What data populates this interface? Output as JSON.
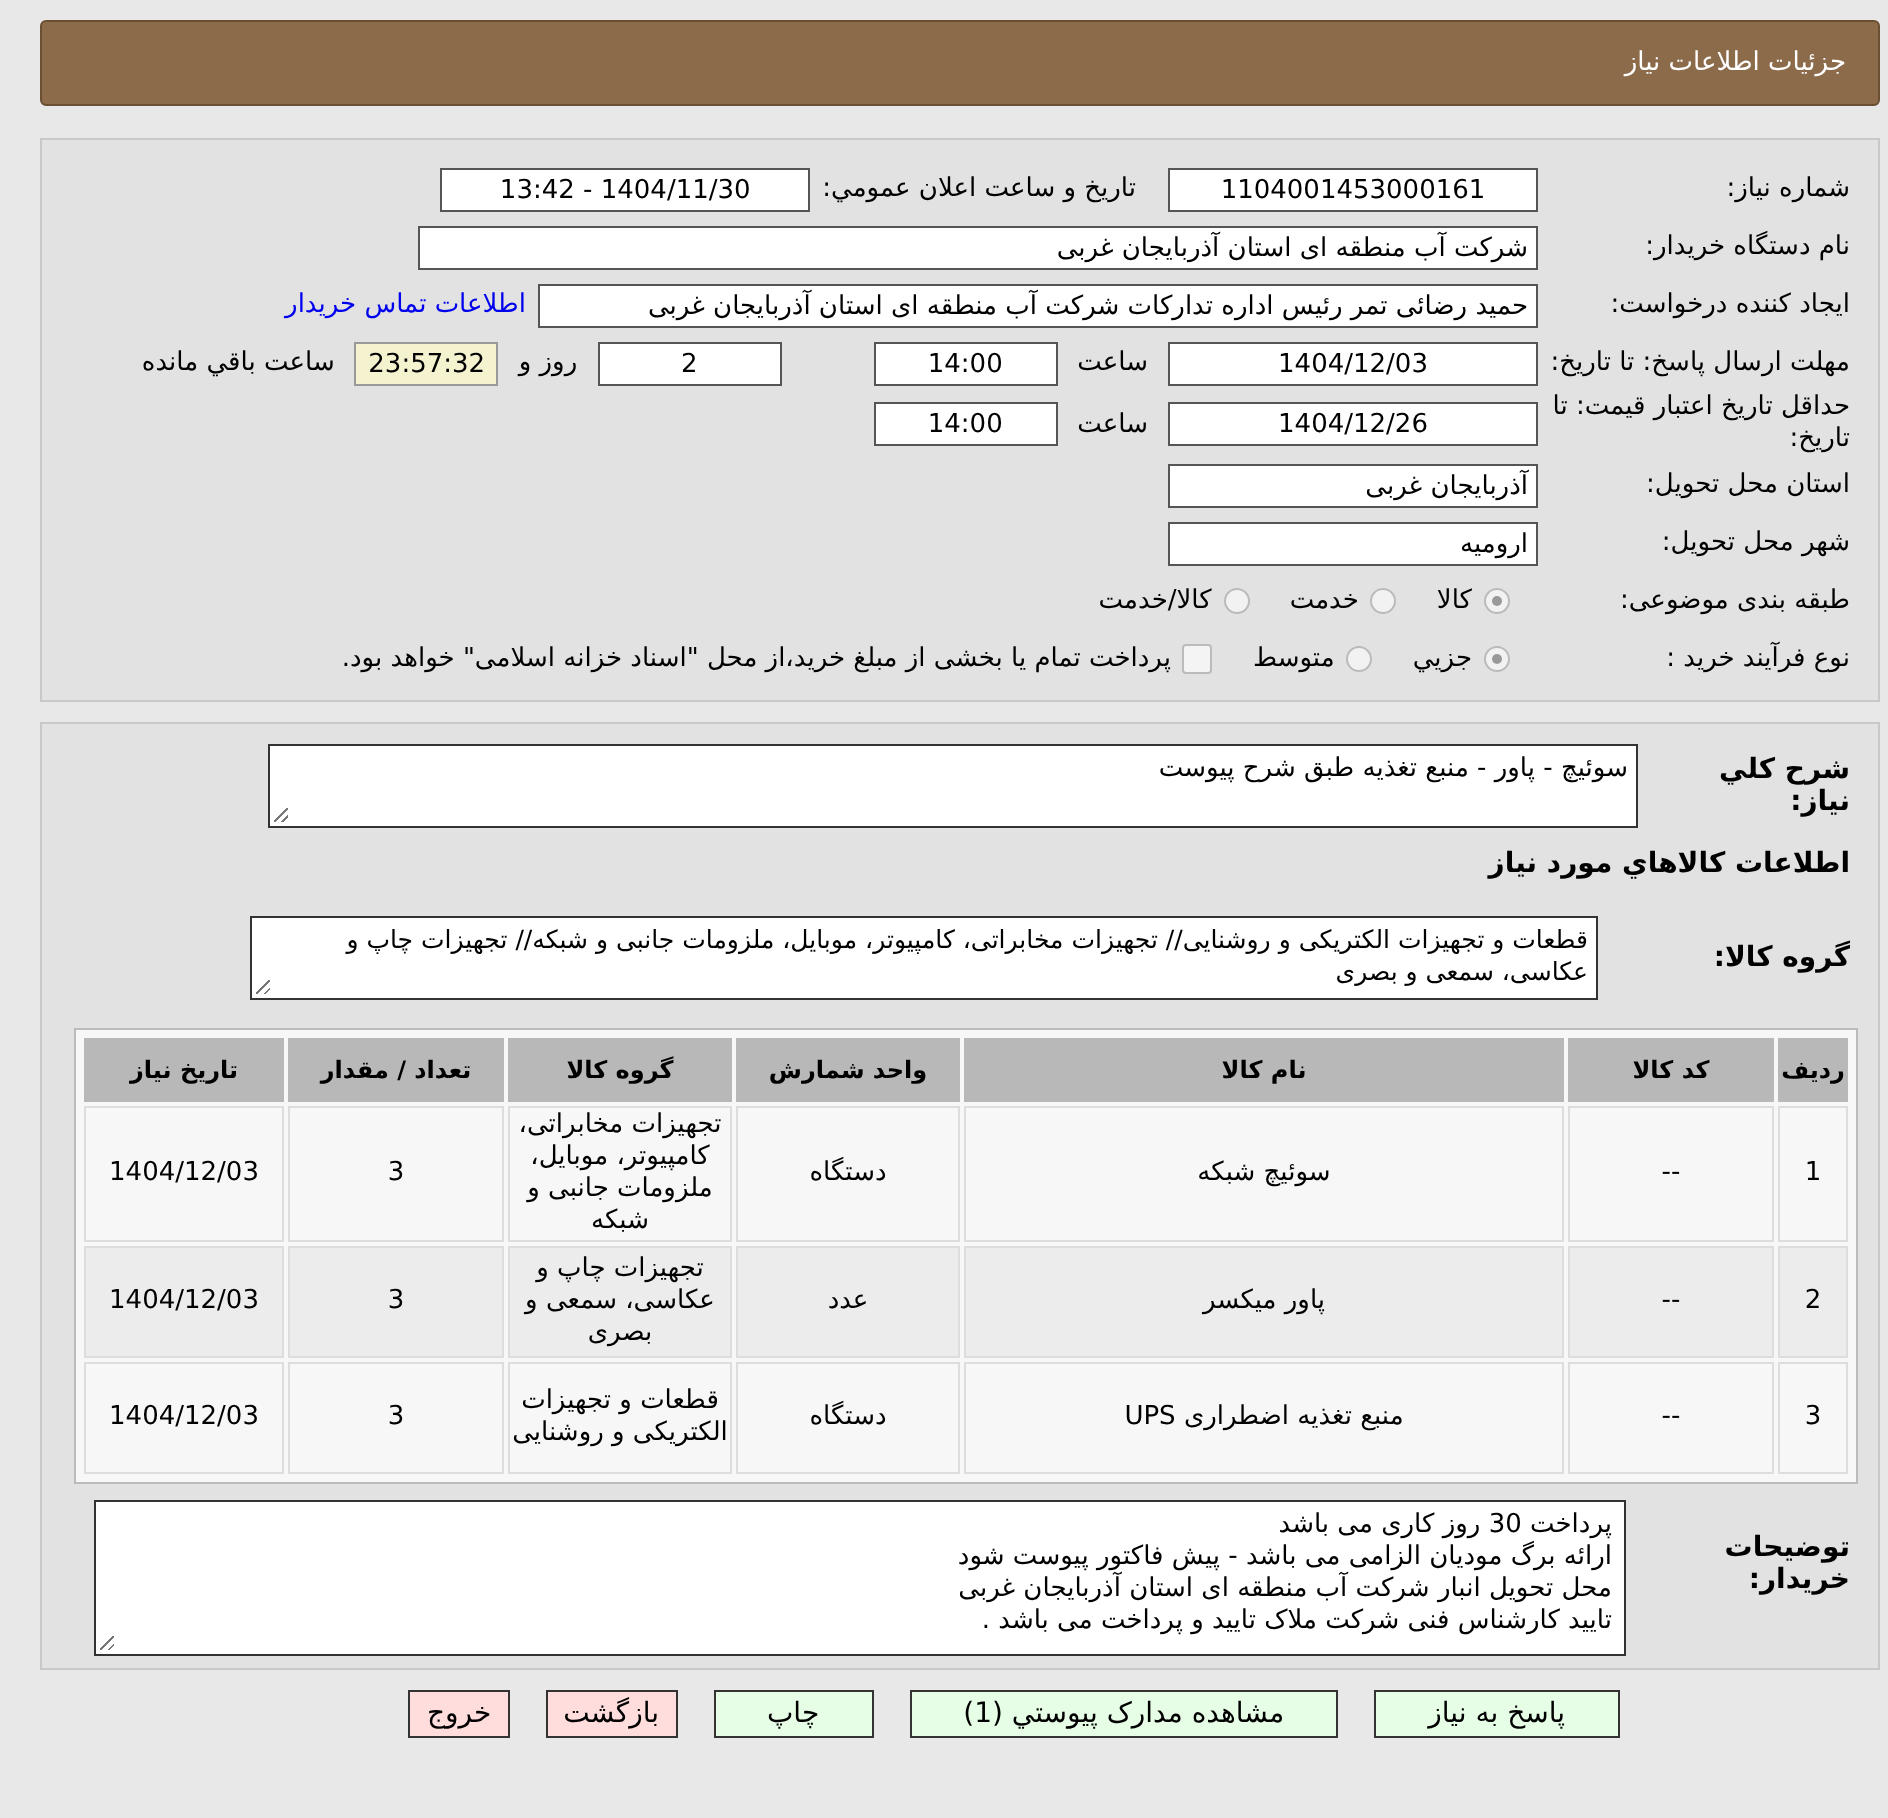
{
  "header": {
    "title": "جزئیات اطلاعات نیاز"
  },
  "details": {
    "need_number": {
      "label": "شماره نیاز:",
      "value": "1104001453000161"
    },
    "announce": {
      "label": "تاریخ و ساعت اعلان عمومي:",
      "value": "1404/11/30 - 13:42"
    },
    "buyer": {
      "label": "نام دستگاه خریدار:",
      "value": "شرکت آب منطقه ای استان آذربایجان غربی"
    },
    "creator": {
      "label": "ایجاد کننده درخواست:",
      "value": "حمید رضائی تمر رئیس اداره تدارکات شرکت آب منطقه ای استان آذربایجان غربی",
      "link": "اطلاعات تماس خریدار"
    },
    "deadline": {
      "label": "مهلت ارسال پاسخ: تا تاریخ:",
      "date": "1404/12/03",
      "time_label": "ساعت",
      "time": "14:00",
      "days": "2",
      "days_label": "روز و",
      "remaining": "23:57:32",
      "remaining_label": "ساعت باقي مانده"
    },
    "validity": {
      "label": "حداقل تاریخ اعتبار قیمت: تا تاریخ:",
      "date": "1404/12/26",
      "time_label": "ساعت",
      "time": "14:00"
    },
    "province": {
      "label": "استان محل تحویل:",
      "value": "آذربایجان غربی"
    },
    "city": {
      "label": "شهر محل تحویل:",
      "value": "ارومیه"
    },
    "category": {
      "label": "طبقه بندی موضوعی:",
      "options": [
        {
          "label": "کالا",
          "selected": true
        },
        {
          "label": "خدمت",
          "selected": false
        },
        {
          "label": "کالا/خدمت",
          "selected": false
        }
      ]
    },
    "process": {
      "label": "نوع فرآیند خرید :",
      "options": [
        {
          "label": "جزيي",
          "selected": true
        },
        {
          "label": "متوسط",
          "selected": false
        }
      ],
      "payment": {
        "checked": false,
        "label": "پرداخت تمام یا بخشی از مبلغ خرید،از محل \"اسناد خزانه اسلامی\" خواهد بود."
      }
    }
  },
  "summary": {
    "label": "شرح كلي نياز:",
    "value": "سوئیچ - پاور - منبع تغذیه طبق شرح پیوست"
  },
  "items_title": "اطلاعات کالاهاي مورد نياز",
  "goods_group": {
    "label": "گروه کالا:",
    "value": "قطعات و تجهیزات الکتریکی و روشنایی// تجهیزات مخابراتی، کامپیوتر، موبایل، ملزومات جانبی و شبکه// تجهیزات چاپ و عکاسی، سمعی و بصری"
  },
  "table": {
    "columns": [
      "ردیف",
      "کد کالا",
      "نام کالا",
      "واحد شمارش",
      "گروه کالا",
      "تعداد / مقدار",
      "تاریخ نیاز"
    ],
    "rows": [
      [
        "1",
        "--",
        "سوئیچ شبکه",
        "دستگاه",
        "تجهیزات مخابراتی، کامپیوتر، موبایل، ملزومات جانبی و شبکه",
        "3",
        "1404/12/03"
      ],
      [
        "2",
        "--",
        "پاور میکسر",
        "عدد",
        "تجهیزات چاپ و عکاسی، سمعی و بصری",
        "3",
        "1404/12/03"
      ],
      [
        "3",
        "--",
        "منبع تغذیه اضطراری UPS",
        "دستگاه",
        "قطعات و تجهیزات الکتریکی و روشنایی",
        "3",
        "1404/12/03"
      ]
    ]
  },
  "notes": {
    "label": "توضیحات خریدار:",
    "lines": [
      "پرداخت 30 روز کاری می باشد",
      "ارائه برگ مودیان الزامی  می باشد - پیش فاکتور پیوست شود",
      "محل تحویل انبار شرکت آب منطقه ای استان آذربایجان غربی",
      "تایید کارشناس فنی شرکت ملاک تایید و پرداخت می باشد ."
    ]
  },
  "buttons": [
    {
      "label": "پاسخ به نياز",
      "kind": "primary"
    },
    {
      "label": "مشاهده مدارک پيوستي (1)",
      "kind": "primary"
    },
    {
      "label": "چاپ",
      "kind": "primary"
    },
    {
      "label": "بازگشت",
      "kind": "danger"
    },
    {
      "label": "خروج",
      "kind": "danger"
    }
  ]
}
